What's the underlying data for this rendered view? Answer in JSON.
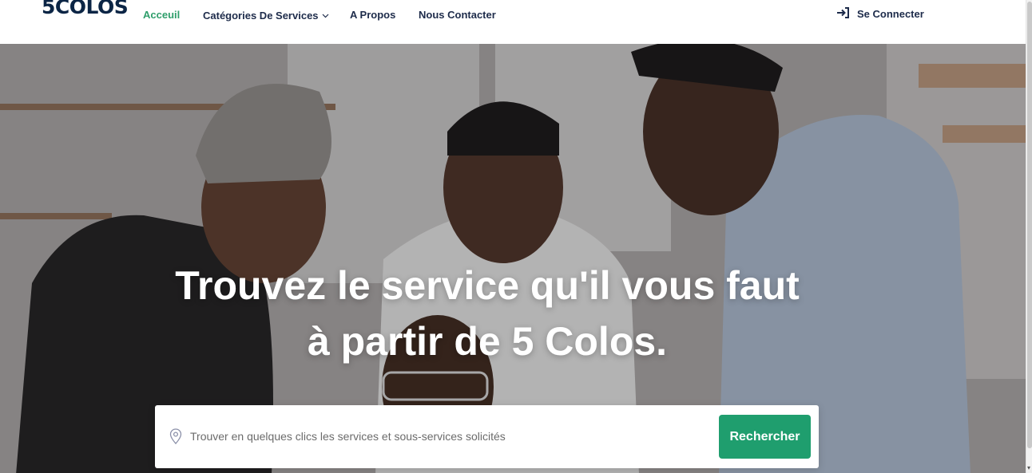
{
  "header": {
    "logo": "5COLOS",
    "nav": [
      {
        "label": "Acceuil",
        "active": true
      },
      {
        "label": "Catégories De Services",
        "has_dropdown": true
      },
      {
        "label": "A Propos"
      },
      {
        "label": "Nous Contacter"
      }
    ],
    "login_label": "Se Connecter",
    "login_icon": "sign-in-icon",
    "dropdown_icon": "chevron-down-icon"
  },
  "hero": {
    "title_line1": "Trouvez le service qu'il vous faut",
    "title_line2": "à partir de 5 Colos."
  },
  "search": {
    "placeholder": "Trouver en quelques clics les services et sous-services solicités",
    "button_label": "Rechercher",
    "icon": "location-pin-icon"
  },
  "colors": {
    "brand_dark": "#0b2545",
    "accent_green": "#1f9e6e",
    "active_nav": "#2f9e6b"
  }
}
